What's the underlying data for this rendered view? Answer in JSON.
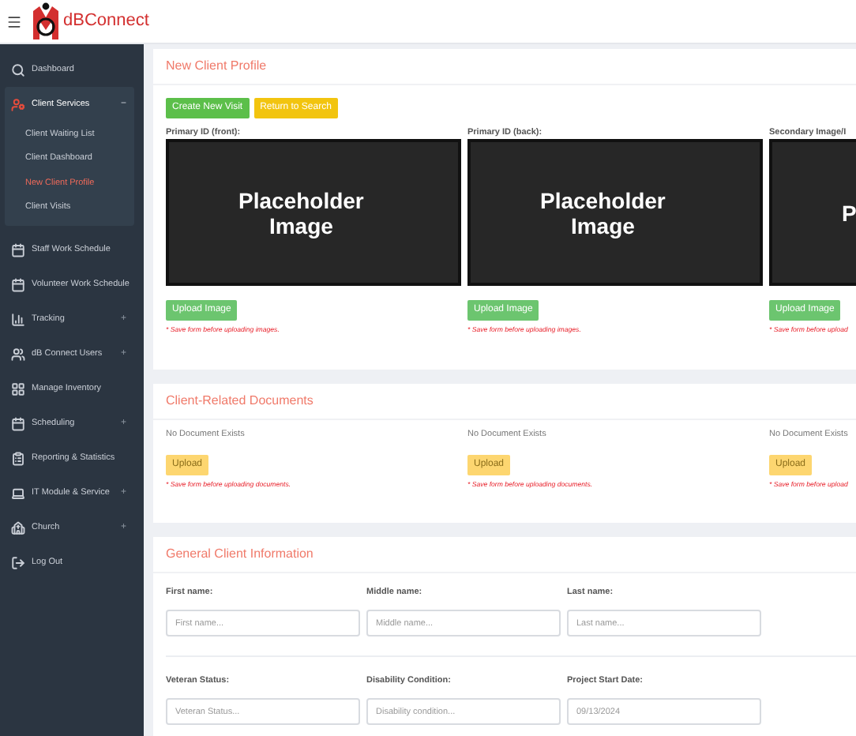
{
  "header": {
    "brand": "dBConnect"
  },
  "sidebar": {
    "items": [
      {
        "label": "Dashboard",
        "selected": false
      },
      {
        "label": "Client Services",
        "selected": true,
        "expanded": true,
        "toggle": "−",
        "children": [
          {
            "label": "Client Waiting List",
            "selected": false
          },
          {
            "label": "Client Dashboard",
            "selected": false
          },
          {
            "label": "New Client Profile",
            "selected": true
          },
          {
            "label": "Client Visits",
            "selected": false
          }
        ]
      },
      {
        "label": "Staff Work Schedule",
        "selected": false
      },
      {
        "label": "Volunteer Work Schedule",
        "selected": false
      },
      {
        "label": "Tracking",
        "selected": false,
        "expanded": false,
        "toggle": "+"
      },
      {
        "label": "dB Connect Users",
        "selected": false,
        "expanded": false,
        "toggle": "+"
      },
      {
        "label": "Manage Inventory",
        "selected": false
      },
      {
        "label": "Scheduling",
        "selected": false,
        "expanded": false,
        "toggle": "+"
      },
      {
        "label": "Reporting & Statistics",
        "selected": false
      },
      {
        "label": "IT Module & Service",
        "selected": false,
        "expanded": false,
        "toggle": "+"
      },
      {
        "label": "Church",
        "selected": false,
        "expanded": false,
        "toggle": "+"
      },
      {
        "label": "Log Out",
        "selected": false
      }
    ]
  },
  "profile_card": {
    "title": "New Client Profile",
    "buttons": [
      {
        "label": "Create New Visit",
        "kind": "green"
      },
      {
        "label": "Return to Search",
        "kind": "yellow"
      }
    ],
    "images": [
      {
        "label": "Primary ID (front):",
        "placeholder": [
          "Placeholder",
          "Image"
        ],
        "button": "Upload Image",
        "note": "* Save form before uploading images."
      },
      {
        "label": "Primary ID (back):",
        "placeholder": [
          "Placeholder",
          "Image"
        ],
        "button": "Upload Image",
        "note": "* Save form before uploading images."
      },
      {
        "label": "Secondary Image/I",
        "placeholder": [
          "P"
        ],
        "button": "Upload Image",
        "note": "* Save form before upload"
      }
    ]
  },
  "documents_card": {
    "title": "Client-Related Documents",
    "documents": [
      {
        "status": "No Document Exists",
        "button": "Upload",
        "note": "* Save form before uploading documents."
      },
      {
        "status": "No Document Exists",
        "button": "Upload",
        "note": "* Save form before uploading documents."
      },
      {
        "status": "No Document Exists",
        "button": "Upload",
        "note": "* Save form before upload"
      }
    ]
  },
  "general_card": {
    "title": "General Client Information",
    "rows": [
      [
        {
          "label": "First name:",
          "placeholder": "First name..."
        },
        {
          "label": "Middle name:",
          "placeholder": "Middle name..."
        },
        {
          "label": "Last name:",
          "placeholder": "Last name..."
        }
      ],
      [
        {
          "label": "Veteran Status:",
          "placeholder": "Veteran Status..."
        },
        {
          "label": "Disability Condition:",
          "placeholder": "Disability condition..."
        },
        {
          "label": "Project Start Date:",
          "placeholder": "09/13/2024"
        }
      ]
    ]
  }
}
